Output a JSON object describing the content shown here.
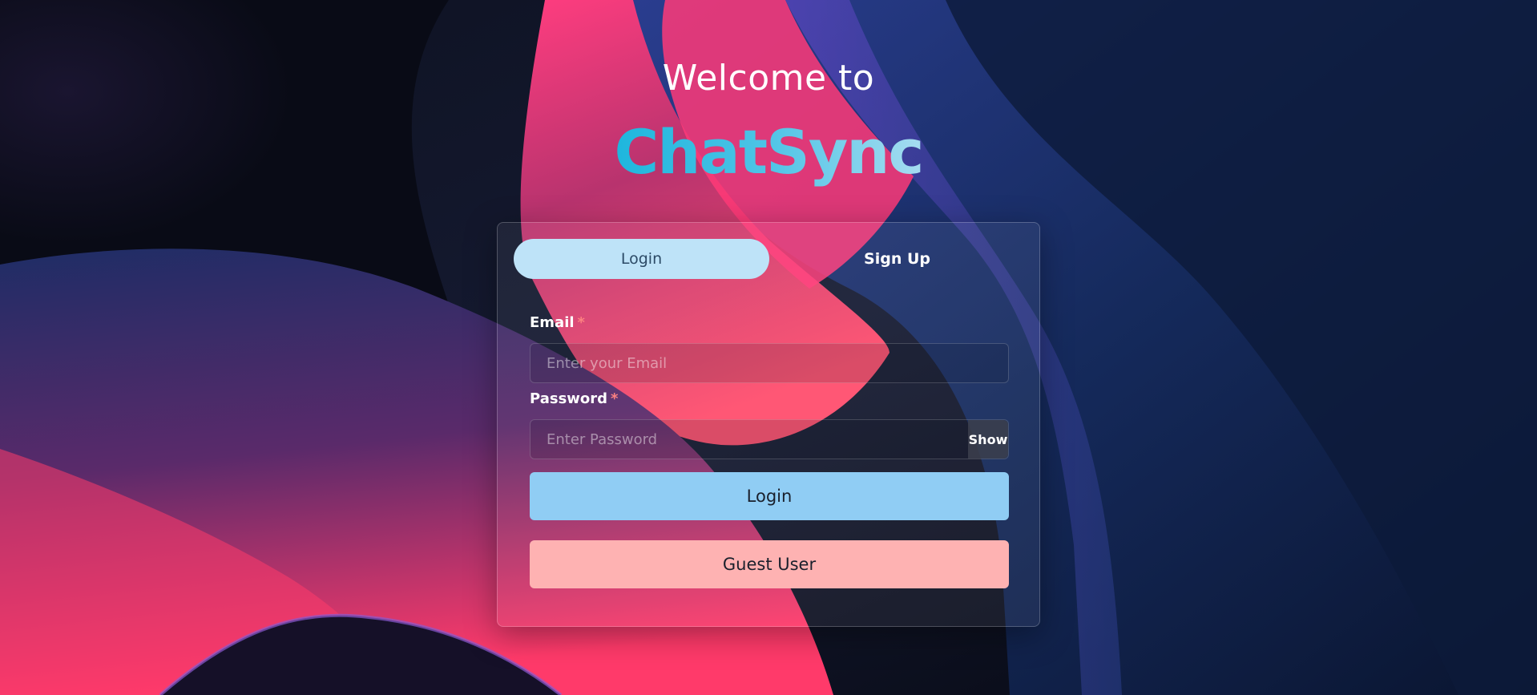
{
  "colors": {
    "tab_active_bg": "#bee3f8",
    "login_button_bg": "#90cdf4",
    "guest_button_bg": "#feb2b2",
    "required_star": "#fc8181",
    "brand_gradient_start": "#1eb6dd",
    "brand_gradient_end": "#a6dcf0"
  },
  "header": {
    "welcome": "Welcome to",
    "brand": "ChatSync"
  },
  "tabs": [
    {
      "label": "Login",
      "active": true
    },
    {
      "label": "Sign Up",
      "active": false
    }
  ],
  "form": {
    "email": {
      "label": "Email",
      "required_mark": "*",
      "placeholder": "Enter your Email",
      "value": ""
    },
    "password": {
      "label": "Password",
      "required_mark": "*",
      "placeholder": "Enter Password",
      "value": "",
      "toggle_label": "Show"
    },
    "login_button": "Login",
    "guest_button": "Guest User"
  }
}
